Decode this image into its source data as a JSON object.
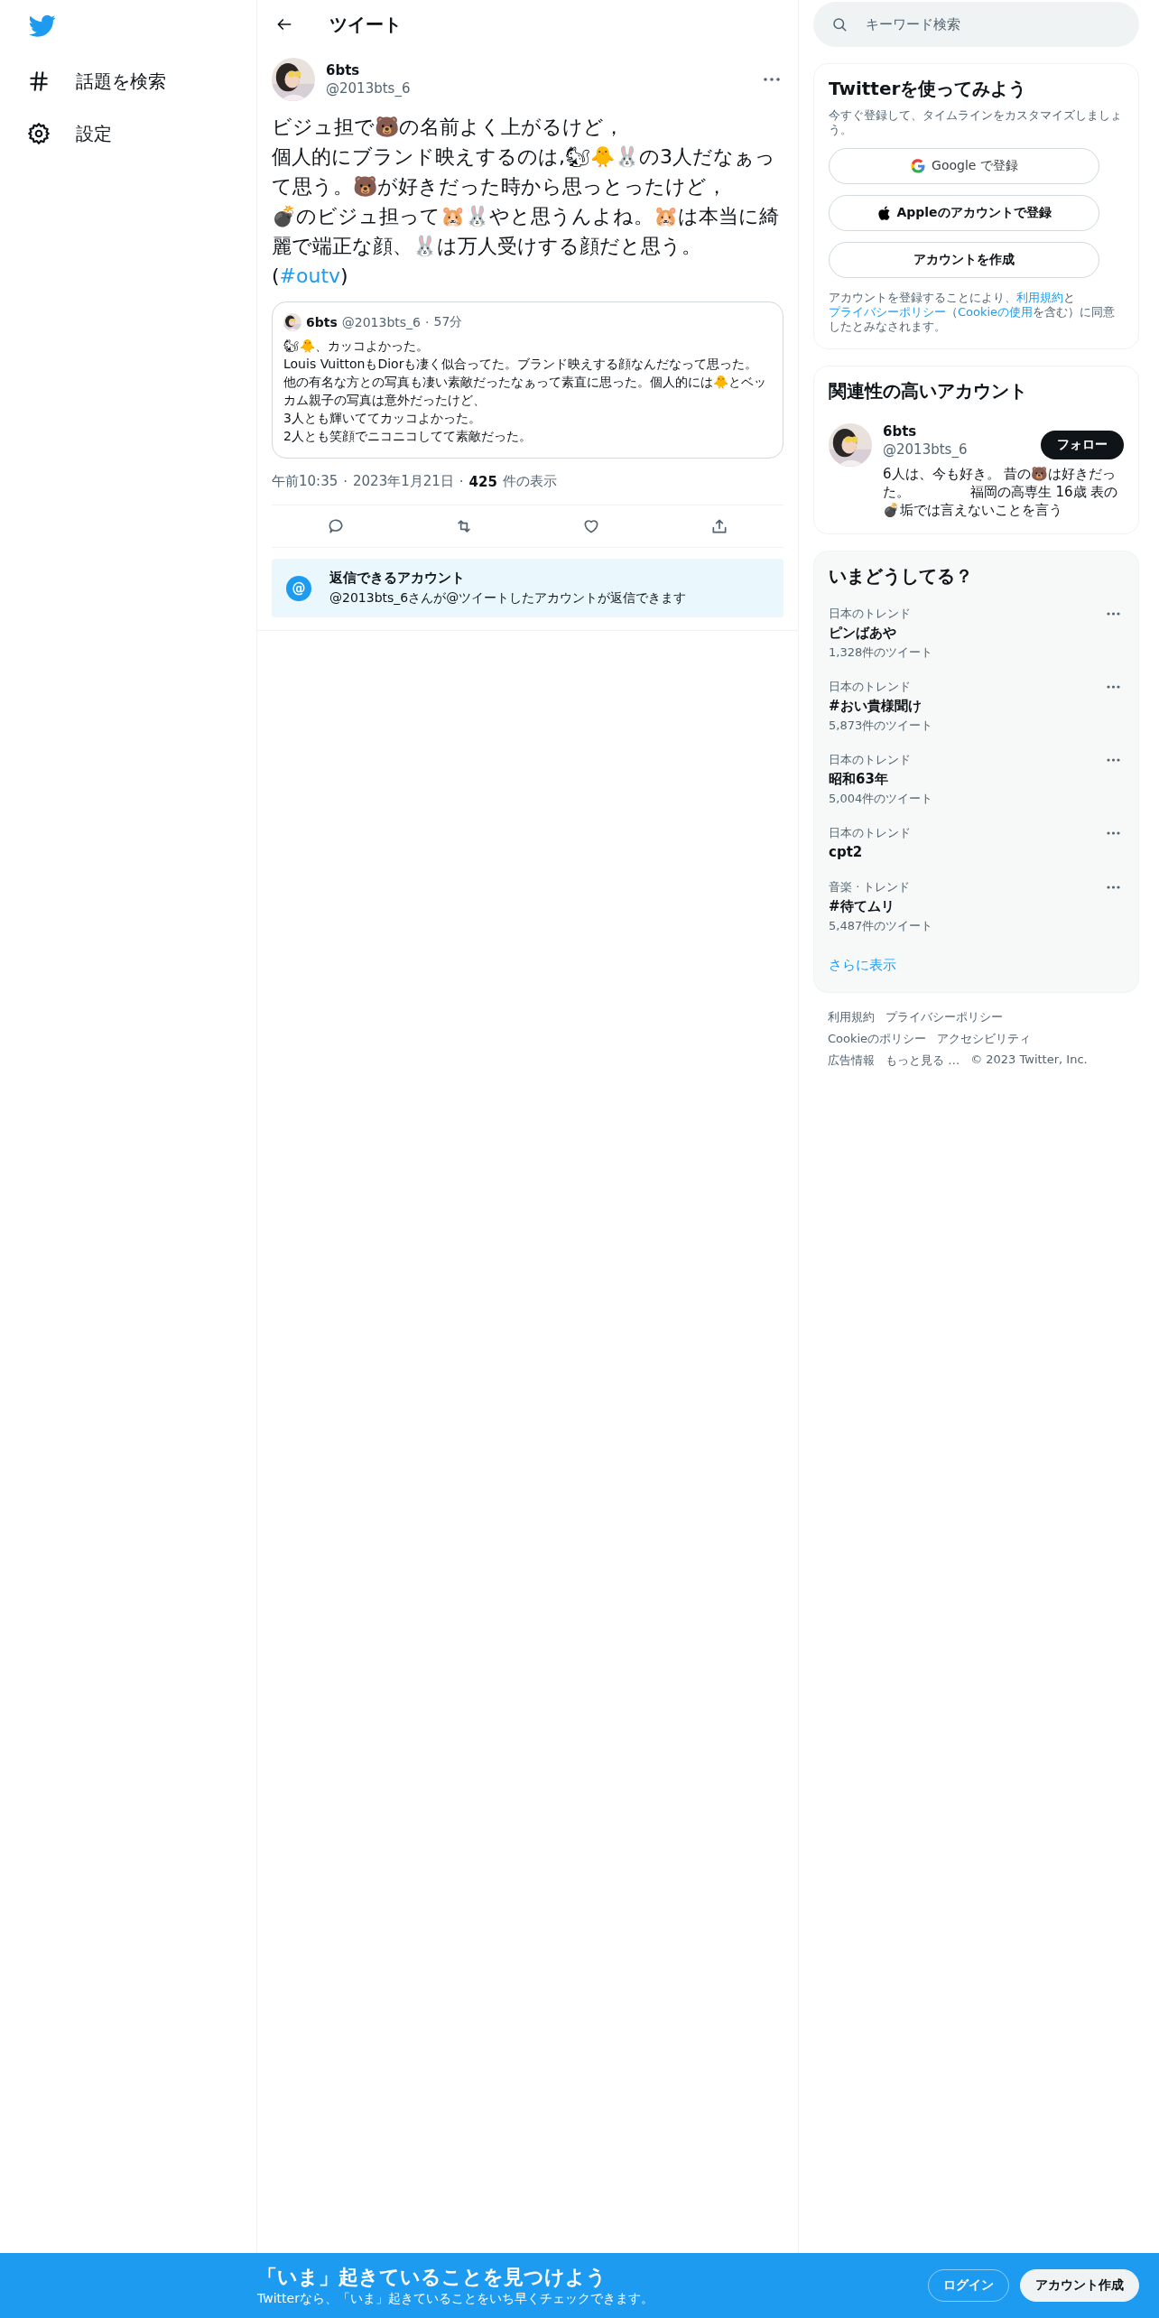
{
  "nav": {
    "items": [
      {
        "kind": "explore",
        "label": "話題を検索"
      },
      {
        "kind": "settings",
        "label": "設定"
      }
    ]
  },
  "header": {
    "title": "ツイート"
  },
  "tweet": {
    "name": "6bts",
    "handle": "@2013bts_6",
    "body": [
      "ビジュ担で🐻の名前よく上がるけど，",
      "個人的にブランド映えするのは,🐿🐥🐰の3人だなぁって思う。🐻が好きだった時から思っとったけど，",
      "💣のビジュ担って🐹🐰やと思うんよね。🐹は本当に綺麗で端正な顔、🐰は万人受けする顔だと思う。"
    ],
    "tag_before": "(",
    "hashtag": "#outv",
    "tag_after": ")",
    "quote": {
      "name": "6bts",
      "handle": "@2013bts_6",
      "separator": "·",
      "age": "57分",
      "body": [
        "🐿🐥、カッコよかった。",
        "Louis VuittonもDiorも凄く似合ってた。ブランド映えする顔なんだなって思った。",
        "他の有名な方との写真も凄い素敵だったなぁって素直に思った。個人的には🐥とベッカム親子の写真は意外だったけど、",
        "3人とも輝いててカッコよかった。",
        "2人とも笑顔でニコニコしてて素敵だった。"
      ]
    },
    "meta": {
      "time": "午前10:35",
      "date": "2023年1月21日",
      "separator": "·",
      "views": "425",
      "views_label": "件の表示"
    },
    "actions": [
      {
        "kind": "reply"
      },
      {
        "kind": "retweet"
      },
      {
        "kind": "like"
      },
      {
        "kind": "share"
      }
    ],
    "reply_notice": {
      "icon": "@",
      "title": "返信できるアカウント",
      "text": "@2013bts_6さんが@ツイートしたアカウントが返信できます"
    }
  },
  "search": {
    "placeholder": "キーワード検索"
  },
  "signup": {
    "title": "Twitterを使ってみよう",
    "subtitle": "今すぐ登録して、タイムラインをカスタマイズしましょう。",
    "buttons": [
      {
        "kind": "google",
        "label": "Google で登録"
      },
      {
        "kind": "apple",
        "label": "Appleのアカウントで登録"
      },
      {
        "kind": "plain",
        "label": "アカウントを作成"
      }
    ],
    "legal": [
      {
        "kind": "text",
        "text": "アカウントを登録することにより、"
      },
      {
        "kind": "link",
        "text": "利用規約"
      },
      {
        "kind": "text",
        "text": "と"
      },
      {
        "kind": "link",
        "text": "プライバシーポリシー"
      },
      {
        "kind": "text",
        "text": "（"
      },
      {
        "kind": "link",
        "text": "Cookieの使用"
      },
      {
        "kind": "text",
        "text": "を含む）に同意したとみなされます。"
      }
    ]
  },
  "related": {
    "title": "関連性の高いアカウント",
    "account": {
      "name": "6bts",
      "handle": "@2013bts_6",
      "follow": "フォロー",
      "bio": "6人は、今も好き。 昔の🐻は好きだった。              福岡の高専生 16歳 表の💣垢では言えないことを言う"
    }
  },
  "trends": {
    "title": "いまどうしてる？",
    "items": [
      {
        "context": "日本のトレンド",
        "name": "ピンばあや",
        "count": "1,328件のツイート"
      },
      {
        "context": "日本のトレンド",
        "name": "#おい貴様聞け",
        "count": "5,873件のツイート"
      },
      {
        "context": "日本のトレンド",
        "name": "昭和63年",
        "count": "5,004件のツイート"
      },
      {
        "context": "日本のトレンド",
        "name": "cpt2"
      },
      {
        "context": "音楽 · トレンド",
        "name": "#待てムリ",
        "count": "5,487件のツイート"
      }
    ],
    "more": "さらに表示"
  },
  "footer": {
    "links": [
      "利用規約",
      "プライバシーポリシー",
      "Cookieのポリシー",
      "アクセシビリティ",
      "広告情報",
      "もっと見る …"
    ],
    "copyright": "© 2023 Twitter, Inc."
  },
  "banner": {
    "title": "「いま」起きていることを見つけよう",
    "subtitle": "Twitterなら、「いま」起きていることをいち早くチェックできます。",
    "login": "ログイン",
    "signup": "アカウント作成"
  }
}
